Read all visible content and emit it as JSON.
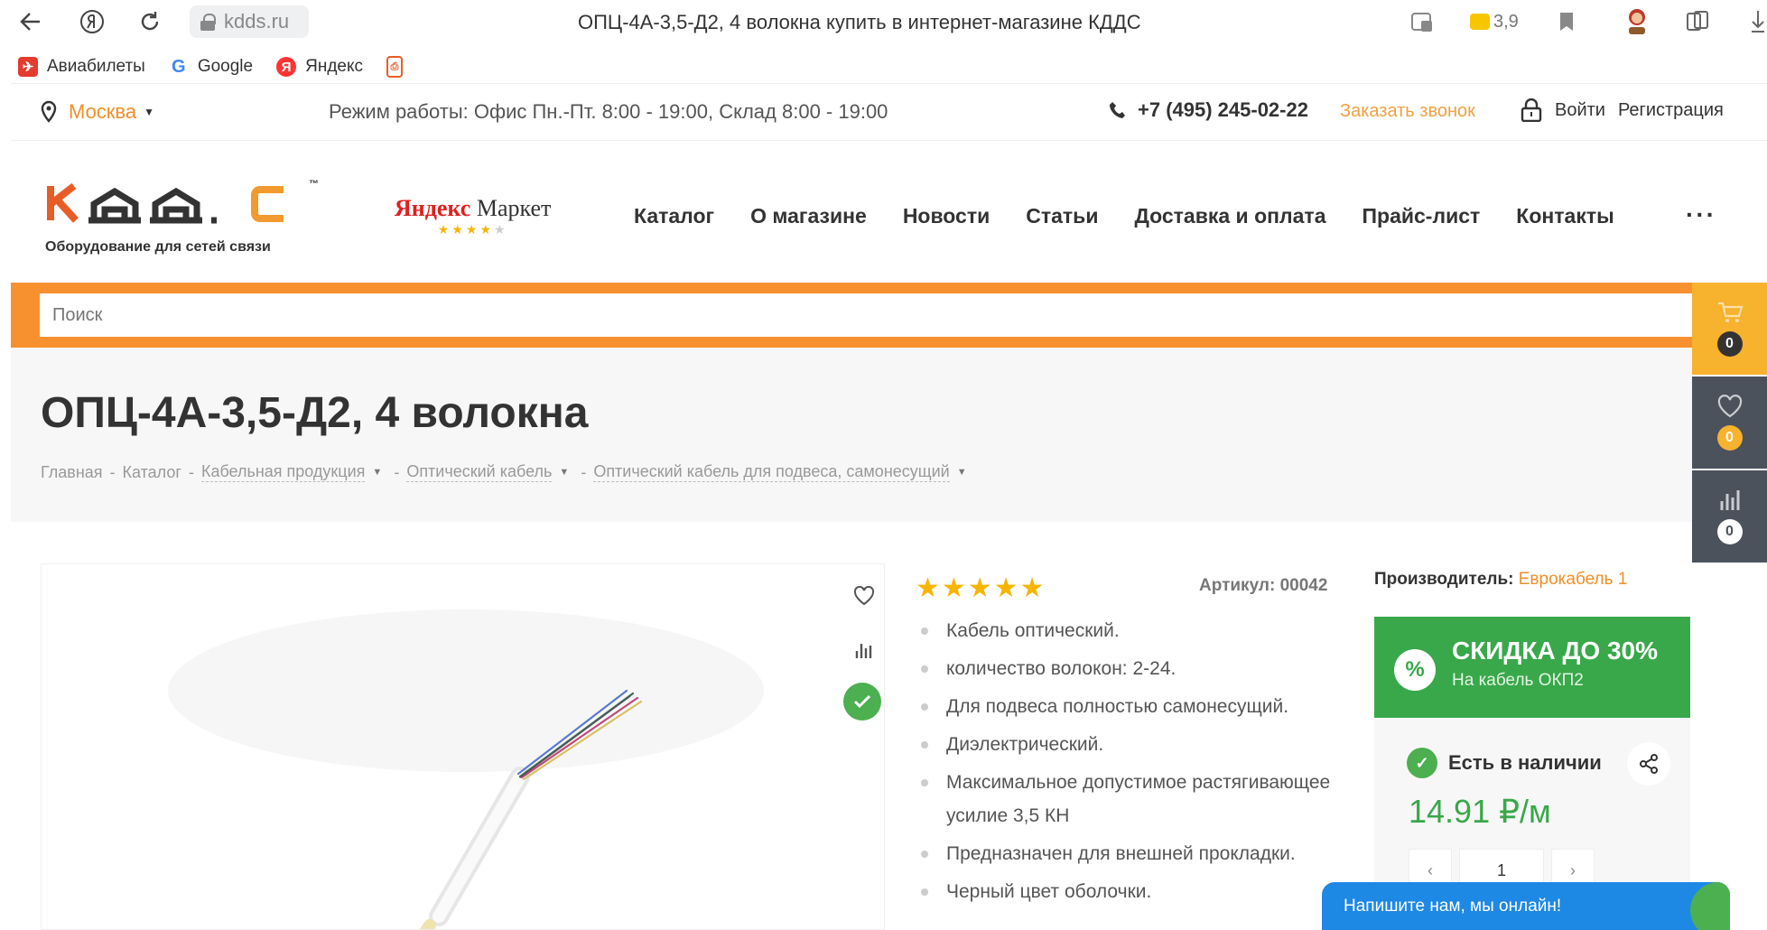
{
  "browser": {
    "url": "kdds.ru",
    "tab_title": "ОПЦ-4А-3,5-Д2, 4 волокна купить в интернет-магазине КДДС",
    "weather": "3,9",
    "bookmarks": [
      {
        "label": "Авиабилеты",
        "icon": "aviatickets-icon",
        "color": "#e33b2e"
      },
      {
        "label": "Google",
        "icon": "google-icon",
        "color": "#4285f4"
      },
      {
        "label": "Яндекс",
        "icon": "yandex-icon",
        "color": "#f33"
      },
      {
        "label": "",
        "icon": "pdf-icon",
        "color": "#e85d26"
      }
    ]
  },
  "topbar": {
    "city": "Москва",
    "hours": "Режим работы: Офис Пн.-Пт. 8:00 - 19:00, Склад 8:00 - 19:00",
    "phone": "+7 (495) 245-02-22",
    "callback": "Заказать звонок",
    "login": "Войти",
    "register": "Регистрация"
  },
  "header": {
    "logo_tagline": "Оборудование для сетей связи",
    "logo_tm": "™",
    "ym_brand": "Яндекс",
    "ym_market": "Маркет",
    "nav": [
      "Каталог",
      "О магазине",
      "Новости",
      "Статьи",
      "Доставка и оплата",
      "Прайс-лист",
      "Контакты"
    ],
    "more": "···"
  },
  "search": {
    "placeholder": "Поиск"
  },
  "side_panel": {
    "cart_count": "0",
    "fav_count": "0",
    "compare_count": "0"
  },
  "product": {
    "title": "ОПЦ-4А-3,5-Д2, 4 волокна",
    "breadcrumbs": [
      "Главная",
      "Каталог",
      "Кабельная продукция",
      "Оптический кабель",
      "Оптический кабель для подвеса, самонесущий"
    ],
    "rating": 5,
    "sku": "Артикул: 00042",
    "features": [
      "Кабель оптический.",
      "количество волокон: 2-24.",
      "Для подвеса полностью самонесущий.",
      "Диэлектрический.",
      "Максимальное допустимое растягивающее усилие 3,5 КН",
      "Предназначен для внешней прокладки.",
      "Черный цвет оболочки."
    ],
    "maker_label": "Производитель:",
    "maker_value": "Еврокабель 1",
    "promo_title": "СКИДКА ДО 30%",
    "promo_sub": "На кабель ОКП2",
    "promo_badge": "%",
    "availability": "Есть в наличии",
    "price": "14.91 ₽/м",
    "qty": "1"
  },
  "chat": {
    "label": "Напишите нам, мы онлайн!"
  },
  "colors": {
    "accent": "#f7902f",
    "green": "#39a84a",
    "dark_panel": "#4b525c",
    "chat": "#1e88e5"
  }
}
